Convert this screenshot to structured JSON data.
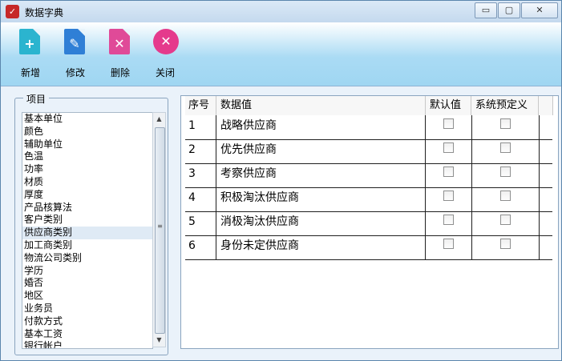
{
  "window": {
    "title": "数据字典",
    "controls": {
      "minimize": "▭",
      "maximize": "▢",
      "close": "✕"
    }
  },
  "toolbar": {
    "buttons": [
      {
        "label": "新增",
        "icon": "add-document-icon",
        "color": "#2bb4cf",
        "glyph": "+"
      },
      {
        "label": "修改",
        "icon": "edit-document-icon",
        "color": "#2f7fd6",
        "glyph": "✎"
      },
      {
        "label": "删除",
        "icon": "delete-document-icon",
        "color": "#e04a98",
        "glyph": "✕"
      },
      {
        "label": "关闭",
        "icon": "close-circle-icon",
        "color": "#e53a8c",
        "glyph": "✕"
      }
    ]
  },
  "items_panel": {
    "title": "项目",
    "items": [
      "基本单位",
      "颜色",
      "辅助单位",
      "色温",
      "功率",
      "材质",
      "厚度",
      "产品核算法",
      "客户类别",
      "供应商类别",
      "加工商类别",
      "物流公司类别",
      "学历",
      "婚否",
      "地区",
      "业务员",
      "付款方式",
      "基本工资",
      "银行帐户"
    ],
    "selected_index": 9
  },
  "grid": {
    "columns": [
      "序号",
      "数据值",
      "默认值",
      "系统预定义"
    ],
    "rows": [
      {
        "no": "1",
        "value": "战略供应商",
        "default": false,
        "system": false
      },
      {
        "no": "2",
        "value": "优先供应商",
        "default": false,
        "system": false
      },
      {
        "no": "3",
        "value": "考察供应商",
        "default": false,
        "system": false
      },
      {
        "no": "4",
        "value": "积极淘汰供应商",
        "default": false,
        "system": false
      },
      {
        "no": "5",
        "value": "消极淘汰供应商",
        "default": false,
        "system": false
      },
      {
        "no": "6",
        "value": "身份未定供应商",
        "default": false,
        "system": false
      }
    ]
  },
  "scrollbar": {
    "up": "▲",
    "down": "▼",
    "grip": "≡"
  }
}
